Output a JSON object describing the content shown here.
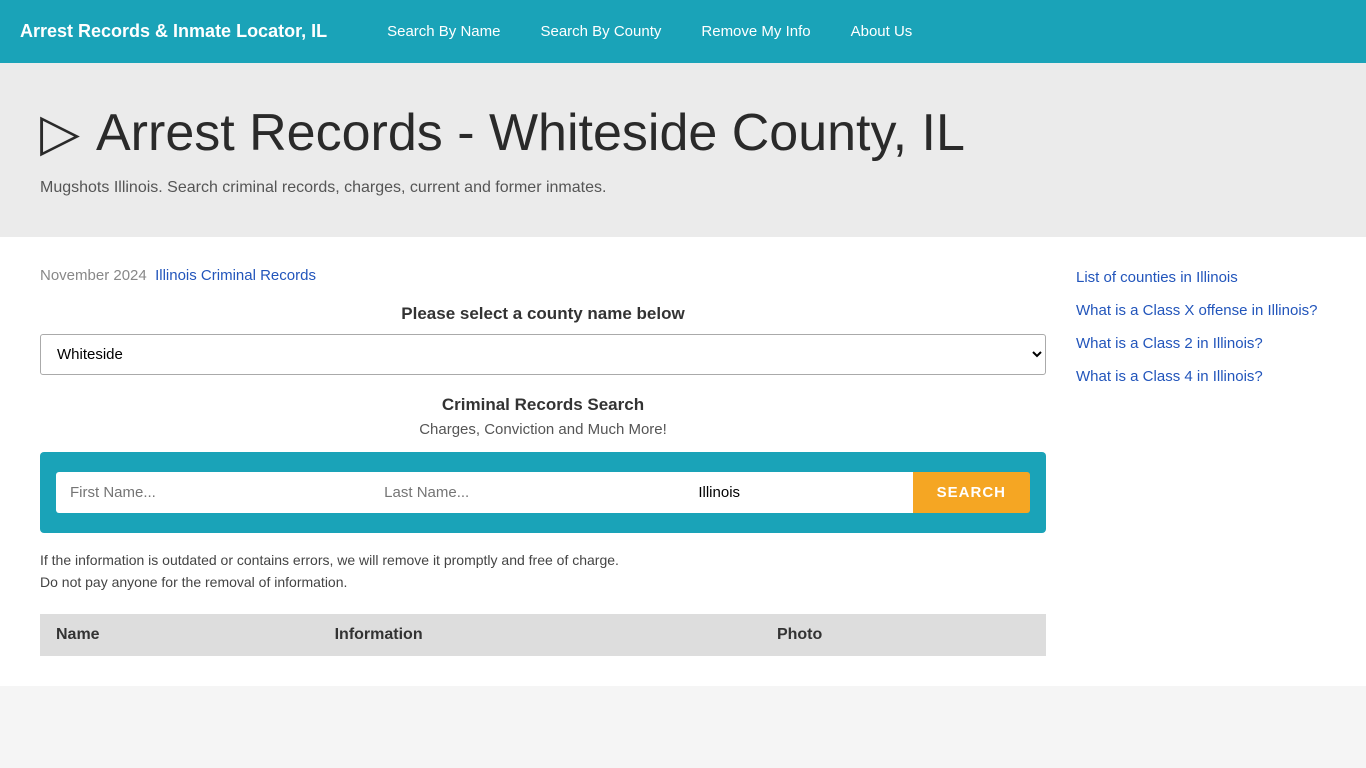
{
  "nav": {
    "brand": "Arrest Records & Inmate Locator, IL",
    "links": [
      {
        "label": "Search By Name",
        "name": "search-by-name"
      },
      {
        "label": "Search By County",
        "name": "search-by-county"
      },
      {
        "label": "Remove My Info",
        "name": "remove-my-info"
      },
      {
        "label": "About Us",
        "name": "about-us"
      }
    ]
  },
  "hero": {
    "icon": "▷",
    "title": "Arrest Records - Whiteside County, IL",
    "subtitle": "Mugshots Illinois. Search criminal records, charges, current and former inmates."
  },
  "main": {
    "date_label": "November 2024",
    "date_link_text": "Illinois Criminal Records",
    "county_section": {
      "label": "Please select a county name below",
      "selected_county": "Whiteside"
    },
    "search_section": {
      "title": "Criminal Records Search",
      "subtitle": "Charges, Conviction and Much More!",
      "first_name_placeholder": "First Name...",
      "last_name_placeholder": "Last Name...",
      "state_value": "Illinois",
      "search_button_label": "SEARCH"
    },
    "disclaimer_line1": "If the information is outdated or contains errors, we will remove it promptly and free of charge.",
    "disclaimer_line2": "Do not pay anyone for the removal of information.",
    "table_headers": [
      "Name",
      "Information",
      "Photo"
    ]
  },
  "sidebar": {
    "links": [
      {
        "text": "List of counties in Illinois"
      },
      {
        "text": "What is a Class X offense in Illinois?"
      },
      {
        "text": "What is a Class 2 in Illinois?"
      },
      {
        "text": "What is a Class 4 in Illinois?"
      }
    ]
  }
}
